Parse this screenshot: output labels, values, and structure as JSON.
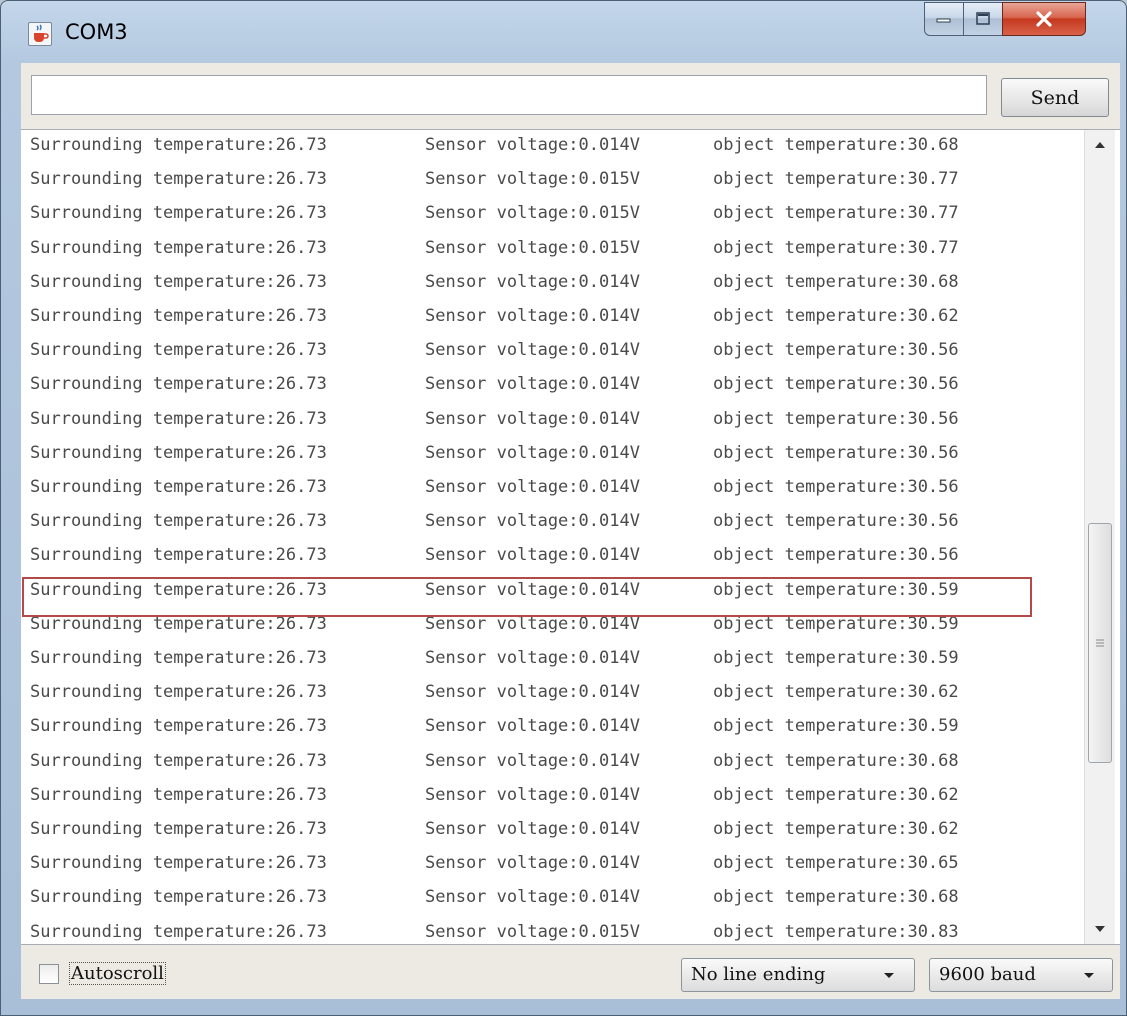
{
  "window": {
    "title": "COM3"
  },
  "toolbar": {
    "input_value": "",
    "send_label": "Send"
  },
  "serial_output": {
    "lines": [
      [
        "Surrounding temperature:26.73",
        "Sensor voltage:0.014V",
        "object temperature:30.68"
      ],
      [
        "Surrounding temperature:26.73",
        "Sensor voltage:0.015V",
        "object temperature:30.77"
      ],
      [
        "Surrounding temperature:26.73",
        "Sensor voltage:0.015V",
        "object temperature:30.77"
      ],
      [
        "Surrounding temperature:26.73",
        "Sensor voltage:0.015V",
        "object temperature:30.77"
      ],
      [
        "Surrounding temperature:26.73",
        "Sensor voltage:0.014V",
        "object temperature:30.68"
      ],
      [
        "Surrounding temperature:26.73",
        "Sensor voltage:0.014V",
        "object temperature:30.62"
      ],
      [
        "Surrounding temperature:26.73",
        "Sensor voltage:0.014V",
        "object temperature:30.56"
      ],
      [
        "Surrounding temperature:26.73",
        "Sensor voltage:0.014V",
        "object temperature:30.56"
      ],
      [
        "Surrounding temperature:26.73",
        "Sensor voltage:0.014V",
        "object temperature:30.56"
      ],
      [
        "Surrounding temperature:26.73",
        "Sensor voltage:0.014V",
        "object temperature:30.56"
      ],
      [
        "Surrounding temperature:26.73",
        "Sensor voltage:0.014V",
        "object temperature:30.56"
      ],
      [
        "Surrounding temperature:26.73",
        "Sensor voltage:0.014V",
        "object temperature:30.56"
      ],
      [
        "Surrounding temperature:26.73",
        "Sensor voltage:0.014V",
        "object temperature:30.56"
      ],
      [
        "Surrounding temperature:26.73",
        "Sensor voltage:0.014V",
        "object temperature:30.59"
      ],
      [
        "Surrounding temperature:26.73",
        "Sensor voltage:0.014V",
        "object temperature:30.59"
      ],
      [
        "Surrounding temperature:26.73",
        "Sensor voltage:0.014V",
        "object temperature:30.59"
      ],
      [
        "Surrounding temperature:26.73",
        "Sensor voltage:0.014V",
        "object temperature:30.62"
      ],
      [
        "Surrounding temperature:26.73",
        "Sensor voltage:0.014V",
        "object temperature:30.59"
      ],
      [
        "Surrounding temperature:26.73",
        "Sensor voltage:0.014V",
        "object temperature:30.68"
      ],
      [
        "Surrounding temperature:26.73",
        "Sensor voltage:0.014V",
        "object temperature:30.62"
      ],
      [
        "Surrounding temperature:26.73",
        "Sensor voltage:0.014V",
        "object temperature:30.62"
      ],
      [
        "Surrounding temperature:26.73",
        "Sensor voltage:0.014V",
        "object temperature:30.65"
      ],
      [
        "Surrounding temperature:26.73",
        "Sensor voltage:0.014V",
        "object temperature:30.68"
      ],
      [
        "Surrounding temperature:26.73",
        "Sensor voltage:0.015V",
        "object temperature:30.83"
      ]
    ],
    "highlighted_line_index": 13,
    "highlight_color": "#b24a4a"
  },
  "footer": {
    "autoscroll_label": "Autoscroll",
    "autoscroll_checked": false,
    "line_ending": "No line ending",
    "baud_rate": "9600 baud"
  },
  "icons": {
    "app": "java-cup-icon",
    "minimize": "minimize-icon",
    "maximize": "maximize-icon",
    "close": "close-icon",
    "scroll_up": "scroll-up-arrow-icon",
    "scroll_down": "scroll-down-arrow-icon",
    "dropdown": "chevron-down-icon"
  }
}
